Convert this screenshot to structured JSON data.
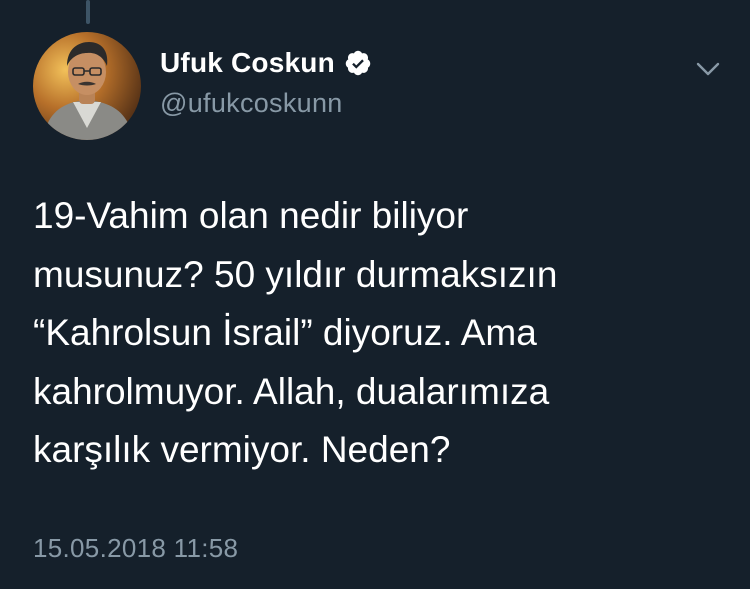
{
  "theme": {
    "background": "#15202b",
    "text_primary": "#ffffff",
    "text_secondary": "#8899a6",
    "verified_badge": "#ffffff"
  },
  "author": {
    "display_name": "Ufuk Coskun",
    "handle": "@ufukcoskunn",
    "verified": true,
    "verified_icon": "verified-badge-icon",
    "avatar_icon": "profile-photo"
  },
  "tweet": {
    "lines": [
      "19-Vahim olan nedir biliyor",
      "musunuz? 50 yıldır durmaksızın",
      "“Kahrolsun İsrail” diyoruz. Ama",
      "kahrolmuyor. Allah, dualarımıza",
      "karşılık vermiyor. Neden?"
    ],
    "timestamp": "15.05.2018 11:58"
  },
  "menu": {
    "icon": "chevron-down-icon"
  }
}
